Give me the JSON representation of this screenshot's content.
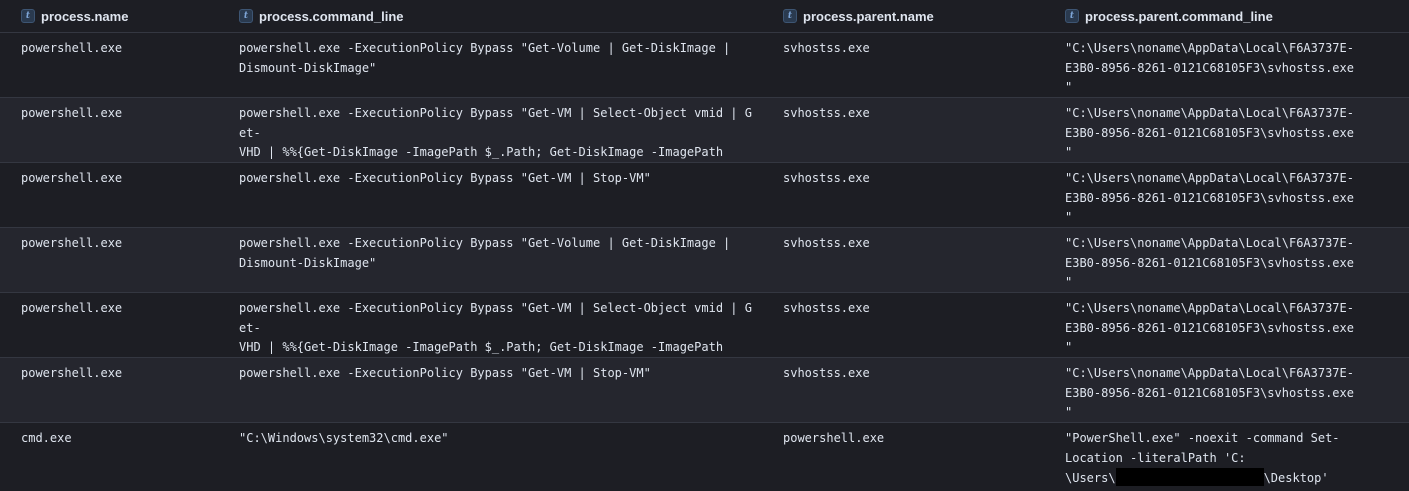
{
  "columns": [
    {
      "name": "process.name",
      "type_icon": "t"
    },
    {
      "name": "process.command_line",
      "type_icon": "t"
    },
    {
      "name": "process.parent.name",
      "type_icon": "t"
    },
    {
      "name": "process.parent.command_line",
      "type_icon": "t"
    }
  ],
  "rows": [
    {
      "name": "powershell.exe",
      "command_line": "powershell.exe -ExecutionPolicy Bypass \"Get-Volume | Get-DiskImage |\nDismount-DiskImage\"",
      "parent_name": "svhostss.exe",
      "parent_command_line": "\"C:\\Users\\noname\\AppData\\Local\\F6A3737E-\nE3B0-8956-8261-0121C68105F3\\svhostss.exe\n\""
    },
    {
      "name": "powershell.exe",
      "command_line": "powershell.exe -ExecutionPolicy Bypass \"Get-VM | Select-Object vmid | Get-\nVHD | %%{Get-DiskImage -ImagePath $_.Path; Get-DiskImage -ImagePath\n$_.ParentPath} | Dismount-DiskImage\"",
      "parent_name": "svhostss.exe",
      "parent_command_line": "\"C:\\Users\\noname\\AppData\\Local\\F6A3737E-\nE3B0-8956-8261-0121C68105F3\\svhostss.exe\n\""
    },
    {
      "name": "powershell.exe",
      "command_line": "powershell.exe -ExecutionPolicy Bypass \"Get-VM | Stop-VM\"",
      "parent_name": "svhostss.exe",
      "parent_command_line": "\"C:\\Users\\noname\\AppData\\Local\\F6A3737E-\nE3B0-8956-8261-0121C68105F3\\svhostss.exe\n\""
    },
    {
      "name": "powershell.exe",
      "command_line": "powershell.exe -ExecutionPolicy Bypass \"Get-Volume | Get-DiskImage |\nDismount-DiskImage\"",
      "parent_name": "svhostss.exe",
      "parent_command_line": "\"C:\\Users\\noname\\AppData\\Local\\F6A3737E-\nE3B0-8956-8261-0121C68105F3\\svhostss.exe\n\""
    },
    {
      "name": "powershell.exe",
      "command_line": "powershell.exe -ExecutionPolicy Bypass \"Get-VM | Select-Object vmid | Get-\nVHD | %%{Get-DiskImage -ImagePath $_.Path; Get-DiskImage -ImagePath\n$_.ParentPath} | Dismount-DiskImage\"",
      "parent_name": "svhostss.exe",
      "parent_command_line": "\"C:\\Users\\noname\\AppData\\Local\\F6A3737E-\nE3B0-8956-8261-0121C68105F3\\svhostss.exe\n\""
    },
    {
      "name": "powershell.exe",
      "command_line": "powershell.exe -ExecutionPolicy Bypass \"Get-VM | Stop-VM\"",
      "parent_name": "svhostss.exe",
      "parent_command_line": "\"C:\\Users\\noname\\AppData\\Local\\F6A3737E-\nE3B0-8956-8261-0121C68105F3\\svhostss.exe\n\""
    }
  ],
  "last_row": {
    "name": "cmd.exe",
    "command_line": "\"C:\\Windows\\system32\\cmd.exe\"",
    "parent_name": "powershell.exe",
    "parent_command_line_prefix": "\"PowerShell.exe\" -noexit -command Set-\nLocation -literalPath 'C:\n\\Users\\",
    "parent_command_line_suffix": "\\Desktop'"
  },
  "colors": {
    "background": "#1d1e24",
    "alt_row": "#25262e",
    "border": "#343741",
    "text": "#dfe5ef",
    "type_icon": "#7ea6d8",
    "redaction": "#000000"
  }
}
